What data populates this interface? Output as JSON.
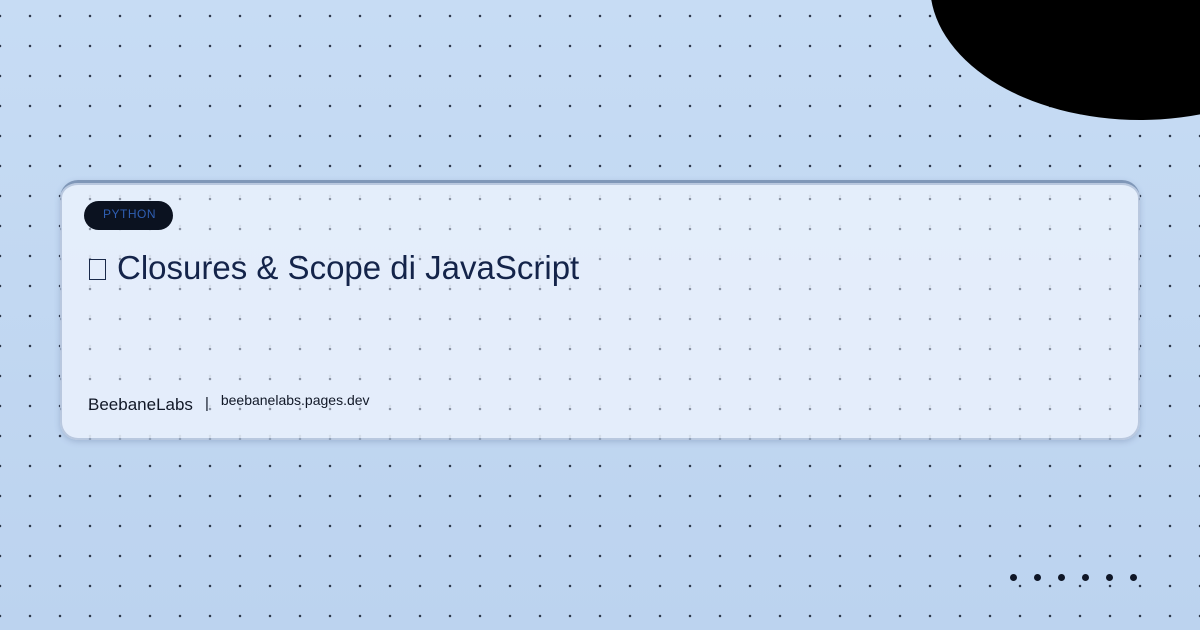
{
  "card": {
    "tag": "PYTHON",
    "title": "Closures & Scope di JavaScript",
    "title_icon": "missing-glyph-icon",
    "brand": "BeebaneLabs",
    "separator": "|",
    "site": "beebanelabs.pages.dev"
  },
  "colors": {
    "background": "#c2d8f2",
    "card": "#e8f0fc",
    "badge": "#0b1220",
    "badge_text": "#2f5fb3",
    "title": "#14244a",
    "corner_blob": "#000000"
  }
}
